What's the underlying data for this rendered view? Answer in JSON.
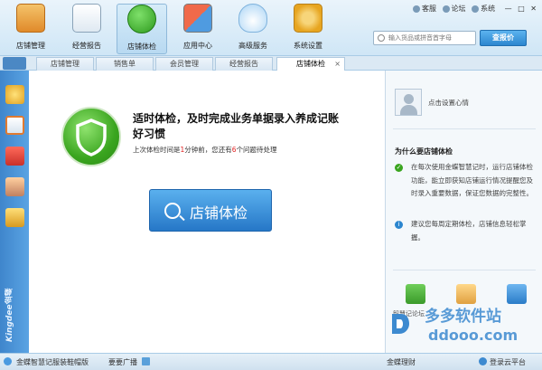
{
  "toolbar": {
    "items": [
      {
        "label": "店铺管理"
      },
      {
        "label": "经营报告"
      },
      {
        "label": "店铺体检"
      },
      {
        "label": "应用中心"
      },
      {
        "label": "高级服务"
      },
      {
        "label": "系统设置"
      }
    ],
    "links": {
      "user": "客服",
      "forum": "论坛",
      "system": "系统"
    }
  },
  "search": {
    "placeholder": "输入货品或拼音首字母",
    "button_label": "查报价"
  },
  "tabs": [
    {
      "label": "店铺管理"
    },
    {
      "label": "销售单"
    },
    {
      "label": "会员管理"
    },
    {
      "label": "经营报告"
    },
    {
      "label": "店铺体检",
      "active": true
    }
  ],
  "tab_close_glyph": "×",
  "sidebar": {
    "icons": [
      "coin-icon",
      "notebook-icon",
      "calendar-icon",
      "contacts-icon",
      "ledger-icon"
    ],
    "brand": "Kingdee金蝶"
  },
  "main": {
    "headline": "适时体检，及时完成业务单据录入养成记账好习惯",
    "status_prefix": "上次体检时间是",
    "status_time": "1",
    "status_mid": "分钟前，您还有",
    "status_count": "6",
    "status_suffix": "个问题待处理",
    "check_button": "店铺体检"
  },
  "right_panel": {
    "mood_placeholder": "点击设置心情",
    "why_title": "为什么要店铺体检",
    "tip1": "在每次使用金蝶智慧记时，运行店铺体检功能，能立即获知店铺运行情况提醒您及时录入重要数据，保证您数据的完整性。",
    "tip2": "建议您每周定期体检，店铺信息轻松掌握。",
    "quick": [
      {
        "label": "智慧记论坛",
        "icon": "forum-icon"
      },
      {
        "label": "",
        "icon": "book-icon"
      },
      {
        "label": "",
        "icon": "help-icon"
      }
    ]
  },
  "watermark": {
    "line1": "多多软件站",
    "line2": "ddooo.com"
  },
  "statusbar": {
    "left": "金蝶智慧记服装鞋帽版",
    "broadcast": "要要广播",
    "center": "金蝶理财",
    "right": "登录云平台"
  },
  "colors": {
    "accent_blue": "#2b86cf",
    "ok_green": "#3aa51f",
    "alert_red": "#e02020"
  }
}
